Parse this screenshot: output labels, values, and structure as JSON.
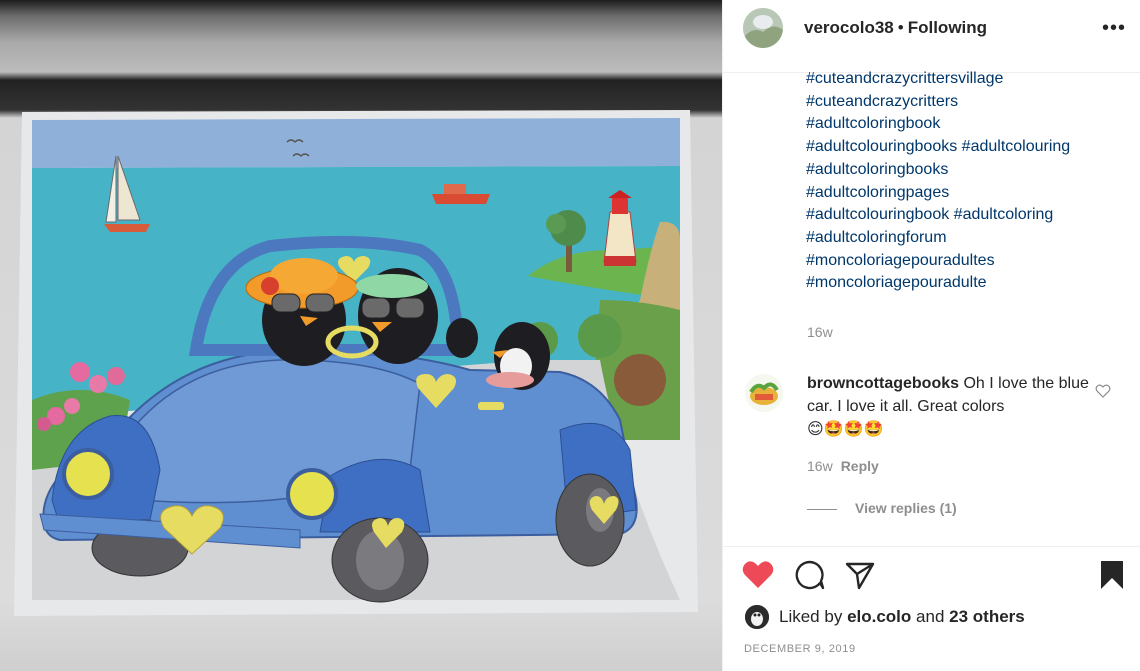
{
  "post": {
    "username": "verocolo38",
    "separator": "•",
    "follow_state": "Following",
    "more_icon": "more-horizontal-icon",
    "more_glyph": "•••"
  },
  "caption": {
    "hashtag_lines": [
      "#cuteandcrazycrittersvillage",
      "#cuteandcrazycritters",
      "#adultcoloringbook",
      "#adultcolouringbooks #adultcolouring",
      "#adultcoloringbooks",
      "#adultcoloringpages",
      "#adultcolouringbook #adultcoloring",
      "#adultcoloringforum",
      "#moncoloriagepouradultes",
      "#moncoloriagepouradulte"
    ],
    "time": "16w"
  },
  "comment": {
    "username": "browncottagebooks",
    "text": "Oh I love the blue car. I love it all. Great colors",
    "emojis": "😊🤩🤩🤩",
    "time": "16w",
    "reply_label": "Reply",
    "view_replies_label": "View replies (1)"
  },
  "likes": {
    "prefix": "Liked by",
    "user": "elo.colo",
    "and": "and",
    "others": "23 others"
  },
  "date": "DECEMBER 9, 2019",
  "colors": {
    "link": "#00376b",
    "like_red": "#ed4956",
    "muted": "#8e8e8e",
    "text": "#262626"
  }
}
